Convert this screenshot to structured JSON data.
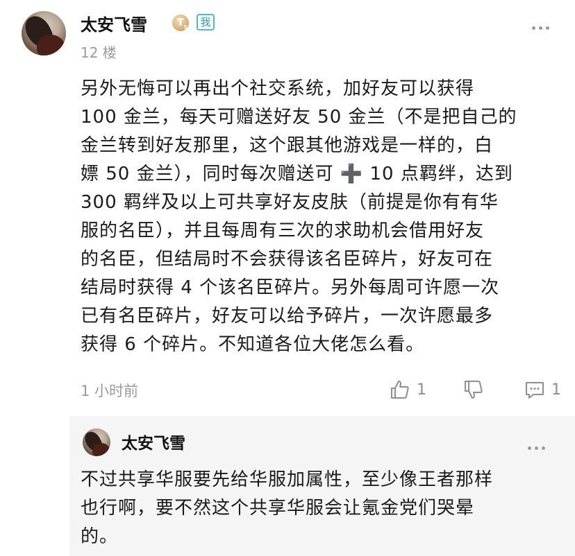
{
  "post": {
    "author": "太安飞雪",
    "level_badge": "T",
    "level_badge_sub": "5",
    "me_badge": "我",
    "floor": "12 楼",
    "content_lines": [
      "另外无悔可以再出个社交系统，加好友可以获得",
      "100 金兰，每天可赠送好友 50 金兰（不是把自己的",
      "金兰转到好友那里，这个跟其他游戏是一样的，白",
      "嫖 50 金兰），同时每次赠送可 ➕ 10 点羁绊，达到",
      "300 羁绊及以上可共享好友皮肤（前提是你有有华",
      "服的名臣），并且每周有三次的求助机会借用好友",
      "的名臣，但结局时不会获得该名臣碎片，好友可在",
      "结局时获得 4 个该名臣碎片。另外每周可许愿一次",
      "已有名臣碎片，好友可以给予碎片，一次许愿最多",
      "获得 6 个碎片。不知道各位大佬怎么看。"
    ],
    "timestamp": "1 小时前",
    "like_count": "1",
    "comment_count": "1"
  },
  "reply": {
    "author": "太安飞雪",
    "text_lines": [
      "不过共享华服要先给华服加属性，至少像王者那样",
      "也行啊，要不然这个共享华服会让氪金党们哭晕",
      "的。"
    ]
  },
  "icons": {
    "more": "more-icon",
    "like": "thumbs-up-icon",
    "dislike": "thumbs-down-icon",
    "comment": "comment-icon"
  },
  "colors": {
    "text": "#1a1a1a",
    "muted": "#9a9a9a",
    "reply_background": "#f5f5f5",
    "me_badge": "#5fb3c8"
  }
}
